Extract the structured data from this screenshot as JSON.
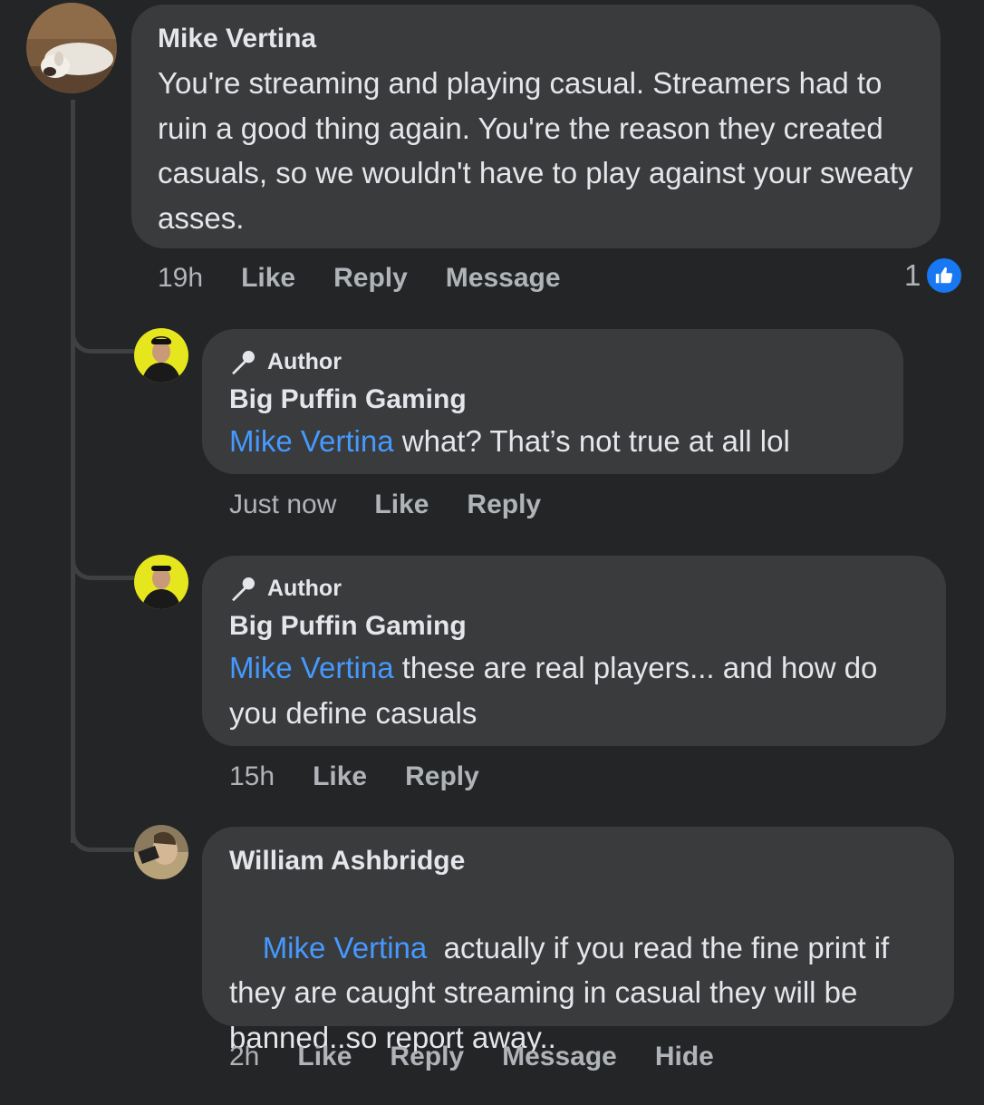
{
  "comments": [
    {
      "author": "Mike Vertina",
      "text": "You're streaming and playing casual. Streamers had to ruin a good thing again. You're the reason they created casuals, so we wouldn't have to play against your sweaty asses.",
      "time": "19h",
      "actions": [
        "Like",
        "Reply",
        "Message"
      ],
      "reaction_count": "1",
      "reaction_icon": "thumbs-up-icon"
    }
  ],
  "replies": [
    {
      "badge": "Author",
      "badge_icon": "microphone-icon",
      "author": "Big Puffin Gaming",
      "mention": "Mike Vertina",
      "text": " what? That’s not true at all lol",
      "time": "Just now",
      "actions": [
        "Like",
        "Reply"
      ]
    },
    {
      "badge": "Author",
      "badge_icon": "microphone-icon",
      "author": "Big Puffin Gaming",
      "mention": "Mike Vertina",
      "text": " these are real players... and how do you define casuals",
      "time": "15h",
      "actions": [
        "Like",
        "Reply"
      ]
    },
    {
      "author": "William Ashbridge",
      "mention": "Mike Vertina",
      "text": "  actually if you read the fine print if they are caught streaming in casual they will be banned..so report away..",
      "time": "2h",
      "actions": [
        "Like",
        "Reply",
        "Message",
        "Hide"
      ]
    }
  ],
  "colors": {
    "background": "#242526",
    "bubble": "#3a3b3c",
    "mention": "#4599ff",
    "like_blue": "#1877f2"
  }
}
